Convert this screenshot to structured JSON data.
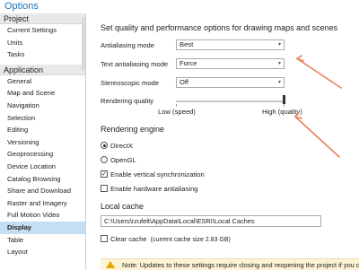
{
  "window": {
    "title": "Options"
  },
  "sidebar": {
    "project_header": "Project",
    "project_items": [
      {
        "label": "Current Settings"
      },
      {
        "label": "Units"
      },
      {
        "label": "Tasks"
      }
    ],
    "application_header": "Application",
    "application_items": [
      {
        "label": "General"
      },
      {
        "label": "Map and Scene"
      },
      {
        "label": "Navigation"
      },
      {
        "label": "Selection"
      },
      {
        "label": "Editing"
      },
      {
        "label": "Versioning"
      },
      {
        "label": "Geoprocessing"
      },
      {
        "label": "Device Location"
      },
      {
        "label": "Catalog Browsing"
      },
      {
        "label": "Share and Download"
      },
      {
        "label": "Raster and Imagery"
      },
      {
        "label": "Full Motion Video"
      },
      {
        "label": "Display",
        "selected": true
      },
      {
        "label": "Table"
      },
      {
        "label": "Layout"
      }
    ]
  },
  "display": {
    "section_title": "Set quality and performance options for drawing maps and scenes",
    "antialiasing": {
      "label": "Antialiasing mode",
      "value": "Best"
    },
    "text_antialiasing": {
      "label": "Text antialiasing mode",
      "value": "Force"
    },
    "stereoscopic": {
      "label": "Stereoscopic mode",
      "value": "Off"
    },
    "rendering_quality": {
      "label": "Rendering quality",
      "low_label": "Low (speed)",
      "high_label": "High (quality)",
      "level": 1.0
    },
    "rendering_engine": {
      "title": "Rendering engine",
      "directx": {
        "label": "DirectX",
        "selected": true
      },
      "opengl": {
        "label": "OpenGL",
        "selected": false
      },
      "vsync": {
        "label": "Enable vertical synchronization",
        "checked": true
      },
      "hw_antialiasing": {
        "label": "Enable hardware antialiasing",
        "checked": false
      }
    },
    "local_cache": {
      "title": "Local cache",
      "path": "C:\\Users\\rzufelt\\AppData\\Local\\ESRI\\Local Caches",
      "clear_label": "Clear cache",
      "cache_size": "(current cache size 2.83 GB)",
      "clear_checked": false
    },
    "note": "Note:  Updates to these settings require closing and reopening the project if you cl"
  },
  "colors": {
    "accent": "#1a73b8",
    "selection": "#c6def2",
    "arrow": "#e8805a",
    "note_bg": "#fdf3d6"
  },
  "icons": {
    "caret": "chevron-down-icon",
    "warning": "warning-icon"
  }
}
